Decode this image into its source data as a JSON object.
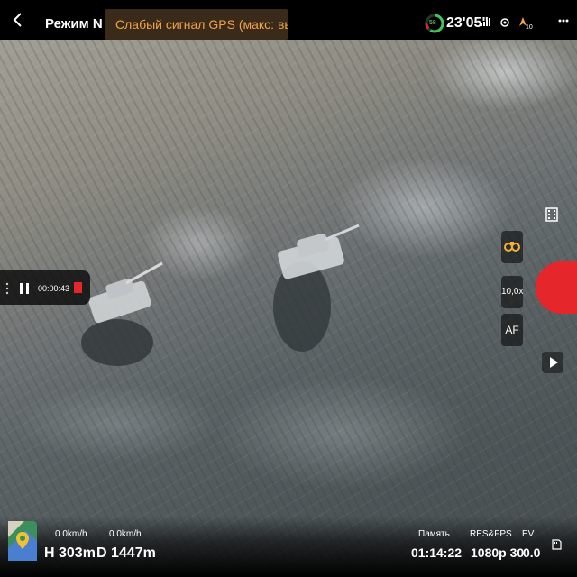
{
  "header": {
    "mode": "Режим N",
    "gps_warning": "Слабый сигнал GPS (макс: выс...",
    "battery_percent": "58",
    "time": "23'05\"",
    "gps_count": "10",
    "colors": {
      "warning_text": "#f0a24a",
      "warning_bg": "#3a2a1a",
      "battery": "#43c35a"
    }
  },
  "recording": {
    "elapsed": "00:00:43",
    "colors": {
      "stop": "#e5262a"
    }
  },
  "camera_controls": {
    "zoom": "10,0x",
    "focus_mode": "AF",
    "icons": [
      "film-icon",
      "binoculars-icon",
      "record-button",
      "play-icon"
    ],
    "colors": {
      "record": "#e5262a"
    }
  },
  "telemetry": {
    "horizontal_speed": "0.0km/h",
    "vertical_speed": "0.0km/h",
    "height": "H 303m",
    "distance": "D 1447m"
  },
  "camera_info": {
    "memory_label": "Память",
    "resfps_label": "RES&FPS",
    "ev_label": "EV",
    "memory_value": "01:14:22",
    "resfps_value": "1080p 30",
    "ev_value": "0.0"
  }
}
